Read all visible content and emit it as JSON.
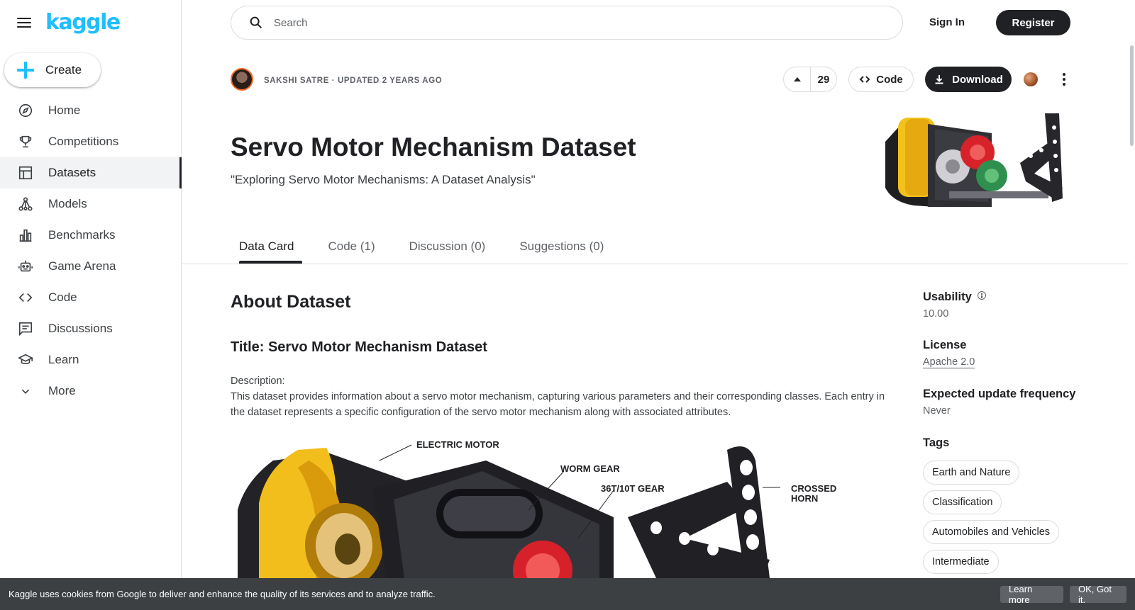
{
  "brand": {
    "logo": "kaggle"
  },
  "sidebar": {
    "create_label": "Create",
    "items": [
      {
        "label": "Home",
        "icon": "compass-icon"
      },
      {
        "label": "Competitions",
        "icon": "trophy-icon"
      },
      {
        "label": "Datasets",
        "icon": "table-icon",
        "active": true
      },
      {
        "label": "Models",
        "icon": "models-icon"
      },
      {
        "label": "Benchmarks",
        "icon": "bar-chart-icon"
      },
      {
        "label": "Game Arena",
        "icon": "robot-icon"
      },
      {
        "label": "Code",
        "icon": "code-icon"
      },
      {
        "label": "Discussions",
        "icon": "comment-icon"
      },
      {
        "label": "Learn",
        "icon": "school-icon"
      },
      {
        "label": "More",
        "icon": "chevron-down-icon"
      }
    ]
  },
  "header": {
    "search_placeholder": "Search",
    "signin_label": "Sign In",
    "register_label": "Register"
  },
  "dataset": {
    "byline": "SAKSHI SATRE · UPDATED 2 YEARS AGO",
    "votes": "29",
    "code_label": "Code",
    "download_label": "Download",
    "title": "Servo Motor Mechanism Dataset",
    "subtitle": "\"Exploring Servo Motor Mechanisms: A Dataset Analysis\""
  },
  "tabs": [
    {
      "label": "Data Card",
      "active": true
    },
    {
      "label": "Code (1)"
    },
    {
      "label": "Discussion (0)"
    },
    {
      "label": "Suggestions (0)"
    }
  ],
  "content": {
    "about_heading": "About Dataset",
    "title_heading": "Title: Servo Motor Mechanism Dataset",
    "description_label": "Description:",
    "description": "This dataset provides information about a servo motor mechanism, capturing various parameters and their corresponding classes. Each entry in the dataset represents a specific configuration of the servo motor mechanism along with associated attributes.",
    "diagram_labels": {
      "electric_motor": "ELECTRIC MOTOR",
      "worm_gear": "WORM GEAR",
      "gear_36t": "36T/10T GEAR",
      "crossed": "CROSSED",
      "horn": "HORN"
    }
  },
  "meta": {
    "usability_heading": "Usability",
    "usability_value": "10.00",
    "license_heading": "License",
    "license_value": "Apache 2.0",
    "frequency_heading": "Expected update frequency",
    "frequency_value": "Never",
    "tags_heading": "Tags",
    "tags": [
      "Earth and Nature",
      "Classification",
      "Automobiles and Vehicles",
      "Intermediate"
    ]
  },
  "cookie": {
    "message": "Kaggle uses cookies from Google to deliver and enhance the quality of its services and to analyze traffic.",
    "learn_more": "Learn more",
    "ok": "OK, Got it."
  },
  "colors": {
    "brand": "#20beff",
    "primary": "#202124",
    "border": "#dadce0",
    "cookie_bg": "#3c4043"
  }
}
